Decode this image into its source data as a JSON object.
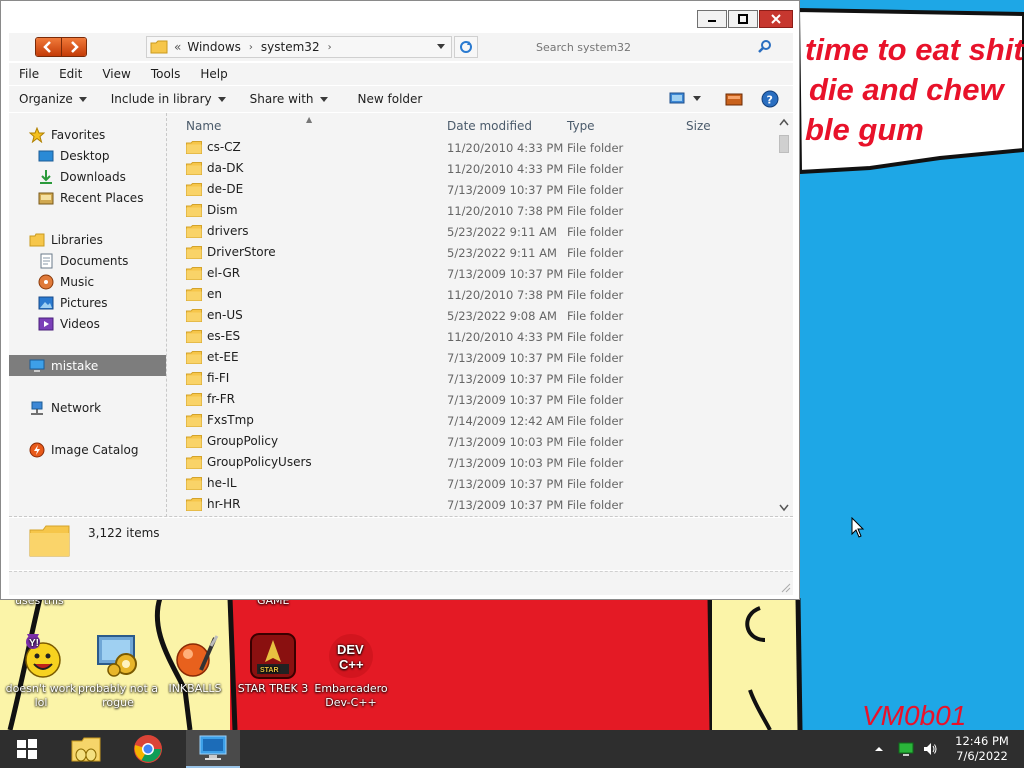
{
  "desktop": {
    "meme_lines": [
      "time to eat shit",
      "die and chew",
      "ble gum"
    ],
    "signature": "VM0b01",
    "icons": [
      {
        "label": "doesn't work lol",
        "icon": "yahoo-messenger-icon"
      },
      {
        "label": "probably not a rogue",
        "icon": "gear-program-icon"
      },
      {
        "label": "INKBALLS",
        "icon": "inkball-icon"
      },
      {
        "label": "STAR TREK 3",
        "icon": "star-trek-icon"
      },
      {
        "label": "Embarcadero Dev-C++",
        "icon": "devcpp-icon"
      }
    ],
    "partial_labels": [
      "uses this",
      "GAME"
    ],
    "devcpp_icon_text": [
      "DEV",
      "C++"
    ]
  },
  "explorer": {
    "address": {
      "overflow": "«",
      "crumbs": [
        "Windows",
        "system32"
      ]
    },
    "search_placeholder": "Search system32",
    "menu": [
      "File",
      "Edit",
      "View",
      "Tools",
      "Help"
    ],
    "toolbar": {
      "organize": "Organize",
      "include": "Include in library",
      "share": "Share with",
      "new_folder": "New folder"
    },
    "nav": {
      "favorites": "Favorites",
      "desktop": "Desktop",
      "downloads": "Downloads",
      "recent": "Recent Places",
      "libraries": "Libraries",
      "documents": "Documents",
      "music": "Music",
      "pictures": "Pictures",
      "videos": "Videos",
      "computer": "mistake",
      "network": "Network",
      "image_catalog": "Image Catalog"
    },
    "columns": {
      "name": "Name",
      "date": "Date modified",
      "type": "Type",
      "size": "Size"
    },
    "files": [
      {
        "name": "cs-CZ",
        "date": "11/20/2010 4:33 PM",
        "type": "File folder"
      },
      {
        "name": "da-DK",
        "date": "11/20/2010 4:33 PM",
        "type": "File folder"
      },
      {
        "name": "de-DE",
        "date": "7/13/2009 10:37 PM",
        "type": "File folder"
      },
      {
        "name": "Dism",
        "date": "11/20/2010 7:38 PM",
        "type": "File folder"
      },
      {
        "name": "drivers",
        "date": "5/23/2022 9:11 AM",
        "type": "File folder"
      },
      {
        "name": "DriverStore",
        "date": "5/23/2022 9:11 AM",
        "type": "File folder"
      },
      {
        "name": "el-GR",
        "date": "7/13/2009 10:37 PM",
        "type": "File folder"
      },
      {
        "name": "en",
        "date": "11/20/2010 7:38 PM",
        "type": "File folder"
      },
      {
        "name": "en-US",
        "date": "5/23/2022 9:08 AM",
        "type": "File folder"
      },
      {
        "name": "es-ES",
        "date": "11/20/2010 4:33 PM",
        "type": "File folder"
      },
      {
        "name": "et-EE",
        "date": "7/13/2009 10:37 PM",
        "type": "File folder"
      },
      {
        "name": "fi-FI",
        "date": "7/13/2009 10:37 PM",
        "type": "File folder"
      },
      {
        "name": "fr-FR",
        "date": "7/13/2009 10:37 PM",
        "type": "File folder"
      },
      {
        "name": "FxsTmp",
        "date": "7/14/2009 12:42 AM",
        "type": "File folder"
      },
      {
        "name": "GroupPolicy",
        "date": "7/13/2009 10:03 PM",
        "type": "File folder"
      },
      {
        "name": "GroupPolicyUsers",
        "date": "7/13/2009 10:03 PM",
        "type": "File folder"
      },
      {
        "name": "he-IL",
        "date": "7/13/2009 10:37 PM",
        "type": "File folder"
      },
      {
        "name": "hr-HR",
        "date": "7/13/2009 10:37 PM",
        "type": "File folder"
      }
    ],
    "item_count": "3,122 items"
  },
  "taskbar": {
    "clock_time": "12:46 PM",
    "clock_date": "7/6/2022"
  },
  "colors": {
    "accent_orange": "#e05a1a",
    "folder_yellow": "#f6c64a",
    "selection_gray": "#7d7d7d",
    "desktop_blue": "#1ea7e6",
    "wallpaper_red": "#e8122a"
  }
}
